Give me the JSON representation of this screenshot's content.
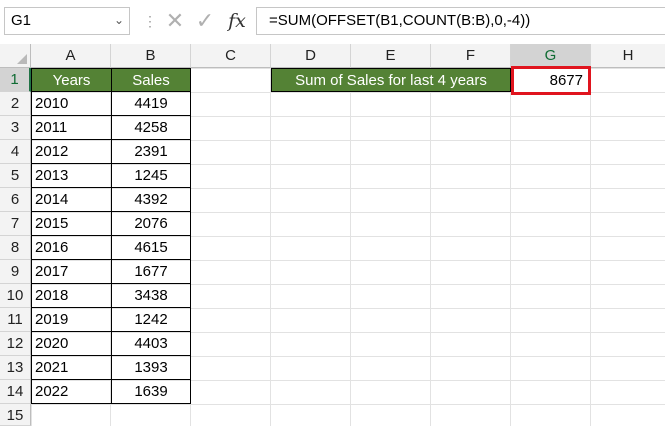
{
  "formula_bar": {
    "name_box": "G1",
    "name_box_arrow_icon": "chevron-down-icon",
    "cancel_icon": "close-icon",
    "enter_icon": "check-icon",
    "fx_label": "fx",
    "formula": "=SUM(OFFSET(B1,COUNT(B:B),0,-4))"
  },
  "columns": [
    "A",
    "B",
    "C",
    "D",
    "E",
    "F",
    "G",
    "H"
  ],
  "selected_column": "G",
  "rows": [
    "1",
    "2",
    "3",
    "4",
    "5",
    "6",
    "7",
    "8",
    "9",
    "10",
    "11",
    "12",
    "13",
    "14",
    "15"
  ],
  "selected_row": "1",
  "table": {
    "headers": [
      "Years",
      "Sales"
    ],
    "data": [
      [
        "2010",
        "4419"
      ],
      [
        "2011",
        "4258"
      ],
      [
        "2012",
        "2391"
      ],
      [
        "2013",
        "1245"
      ],
      [
        "2014",
        "4392"
      ],
      [
        "2015",
        "2076"
      ],
      [
        "2016",
        "4615"
      ],
      [
        "2017",
        "1677"
      ],
      [
        "2018",
        "3438"
      ],
      [
        "2019",
        "1242"
      ],
      [
        "2020",
        "4403"
      ],
      [
        "2021",
        "1393"
      ],
      [
        "2022",
        "1639"
      ]
    ]
  },
  "summary": {
    "label": "Sum of Sales for last 4 years",
    "value": "8677"
  },
  "colors": {
    "header_fill": "#548235",
    "header_text": "#ffffff",
    "highlight_border": "#e0141e",
    "selection_accent": "#217346"
  }
}
